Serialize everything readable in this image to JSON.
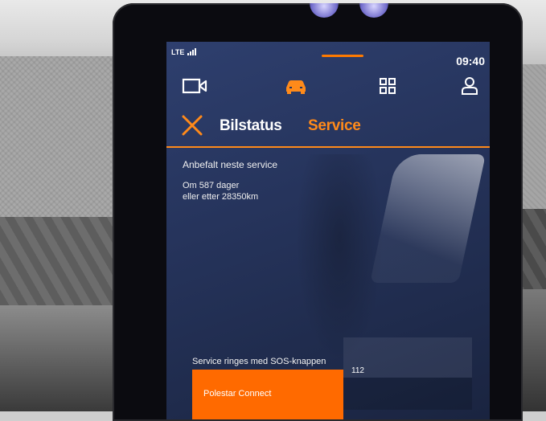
{
  "status_bar": {
    "network": "LTE",
    "time": "09:40"
  },
  "nav": {
    "icons": [
      "camera-icon",
      "car-icon",
      "apps-grid-icon",
      "profile-icon"
    ],
    "accent_color": "#ff8a1a"
  },
  "header": {
    "tabs": [
      {
        "label": "Bilstatus",
        "active": false
      },
      {
        "label": "Service",
        "active": true
      }
    ]
  },
  "service": {
    "heading": "Anbefalt neste service",
    "days_line": "Om 587 dager",
    "km_line": "eller etter 28350km"
  },
  "sos": {
    "label": "Service ringes med SOS-knappen",
    "button_label": "Polestar Connect",
    "number": "112",
    "button_color": "#ff6a00"
  }
}
